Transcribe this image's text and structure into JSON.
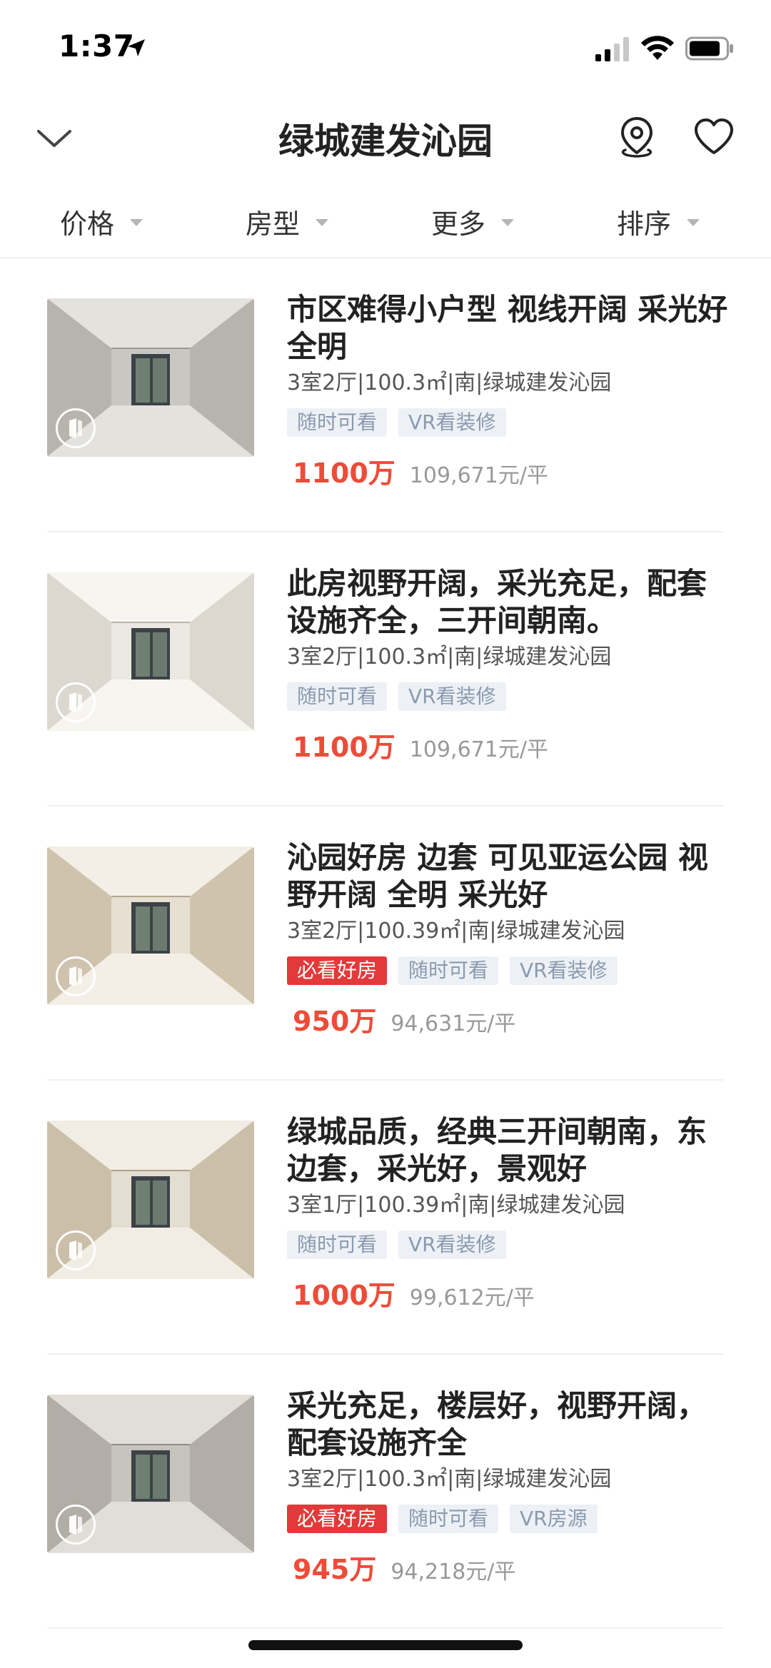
{
  "status_bar": {
    "time": "1:37"
  },
  "header": {
    "title": "绿城建发沁园"
  },
  "filters": [
    {
      "label": "价格"
    },
    {
      "label": "房型"
    },
    {
      "label": "更多"
    },
    {
      "label": "排序"
    }
  ],
  "listings": [
    {
      "title": "市区难得小户型 视线开阔 采光好 全明",
      "meta": "3室2厅|100.3㎡|南|绿城建发沁园",
      "tags": [
        {
          "label": "随时可看",
          "hot": false
        },
        {
          "label": "VR看装修",
          "hot": false
        }
      ],
      "price": "1100万",
      "unit_price": "109,671元/平"
    },
    {
      "title": "此房视野开阔，采光充足，配套设施齐全，三开间朝南。",
      "meta": "3室2厅|100.3㎡|南|绿城建发沁园",
      "tags": [
        {
          "label": "随时可看",
          "hot": false
        },
        {
          "label": "VR看装修",
          "hot": false
        }
      ],
      "price": "1100万",
      "unit_price": "109,671元/平"
    },
    {
      "title": "沁园好房 边套 可见亚运公园 视野开阔 全明 采光好",
      "meta": "3室2厅|100.39㎡|南|绿城建发沁园",
      "tags": [
        {
          "label": "必看好房",
          "hot": true
        },
        {
          "label": "随时可看",
          "hot": false
        },
        {
          "label": "VR看装修",
          "hot": false
        }
      ],
      "price": "950万",
      "unit_price": "94,631元/平"
    },
    {
      "title": "绿城品质，经典三开间朝南，东边套，采光好，景观好",
      "meta": "3室1厅|100.39㎡|南|绿城建发沁园",
      "tags": [
        {
          "label": "随时可看",
          "hot": false
        },
        {
          "label": "VR看装修",
          "hot": false
        }
      ],
      "price": "1000万",
      "unit_price": "99,612元/平"
    },
    {
      "title": "采光充足，楼层好，视野开阔，配套设施齐全",
      "meta": "3室2厅|100.3㎡|南|绿城建发沁园",
      "tags": [
        {
          "label": "必看好房",
          "hot": true
        },
        {
          "label": "随时可看",
          "hot": false
        },
        {
          "label": "VR房源",
          "hot": false
        }
      ],
      "price": "945万",
      "unit_price": "94,218元/平"
    }
  ],
  "colors": {
    "price": "#ee4b38",
    "hot_tag": "#e2393a",
    "tag_bg": "#edf1f6",
    "tag_text": "#8a9aaf"
  }
}
